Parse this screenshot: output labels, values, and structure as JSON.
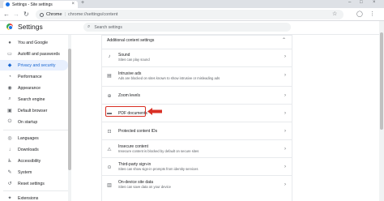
{
  "browser": {
    "tab_title": "Settings - Site settings",
    "new_tab_symbol": "+",
    "close_symbol": "×",
    "omnibox_host": "Chrome",
    "omnibox_sep": "|",
    "omnibox_path": "chrome://settings/content"
  },
  "header": {
    "title": "Settings",
    "search_placeholder": "Search settings"
  },
  "sidebar": {
    "items": [
      {
        "label": "You and Google",
        "icon": "person-icon",
        "glyph": "●"
      },
      {
        "label": "Autofill and passwords",
        "icon": "autofill-icon",
        "glyph": "▭"
      },
      {
        "label": "Privacy and security",
        "icon": "shield-icon",
        "glyph": "◆"
      },
      {
        "label": "Performance",
        "icon": "speedometer-icon",
        "glyph": "◔"
      },
      {
        "label": "Appearance",
        "icon": "palette-icon",
        "glyph": "◉"
      },
      {
        "label": "Search engine",
        "icon": "search-icon",
        "glyph": "⌕"
      },
      {
        "label": "Default browser",
        "icon": "browser-icon",
        "glyph": "▣"
      },
      {
        "label": "On startup",
        "icon": "power-icon",
        "glyph": "⏻"
      },
      {
        "label": "Languages",
        "icon": "globe-icon",
        "glyph": "◎"
      },
      {
        "label": "Downloads",
        "icon": "download-icon",
        "glyph": "↓"
      },
      {
        "label": "Accessibility",
        "icon": "accessibility-icon",
        "glyph": "♿"
      },
      {
        "label": "System",
        "icon": "wrench-icon",
        "glyph": "✎"
      },
      {
        "label": "Reset settings",
        "icon": "reset-icon",
        "glyph": "↺"
      },
      {
        "label": "Extensions",
        "icon": "puzzle-icon",
        "glyph": "✦"
      }
    ]
  },
  "content": {
    "section_label": "Additional content settings",
    "rows": [
      {
        "title": "Sound",
        "subtitle": "Sites can play sound",
        "icon": "sound-icon",
        "glyph": "♪"
      },
      {
        "title": "Intrusive ads",
        "subtitle": "Ads are blocked on sites known to show intrusive or misleading ads",
        "icon": "ads-icon",
        "glyph": "▤"
      },
      {
        "title": "Zoom levels",
        "subtitle": "",
        "icon": "zoom-icon",
        "glyph": "⊕"
      },
      {
        "title": "PDF documents",
        "subtitle": "",
        "icon": "pdf-icon",
        "glyph": "▬"
      },
      {
        "title": "Protected content IDs",
        "subtitle": "",
        "icon": "protected-content-icon",
        "glyph": "⊡"
      },
      {
        "title": "Insecure content",
        "subtitle": "Insecure content is blocked by default on secure sites",
        "icon": "warning-icon",
        "glyph": "⚠"
      },
      {
        "title": "Third-party sign-in",
        "subtitle": "Sites can show sign-in prompts from identity services",
        "icon": "signin-icon",
        "glyph": "⊙"
      },
      {
        "title": "On-device site data",
        "subtitle": "Sites can save data on your device",
        "icon": "storage-icon",
        "glyph": "▥"
      }
    ]
  },
  "colors": {
    "accent": "#1a73e8",
    "active_bg": "#e8f0fe",
    "highlight": "#d93025"
  }
}
